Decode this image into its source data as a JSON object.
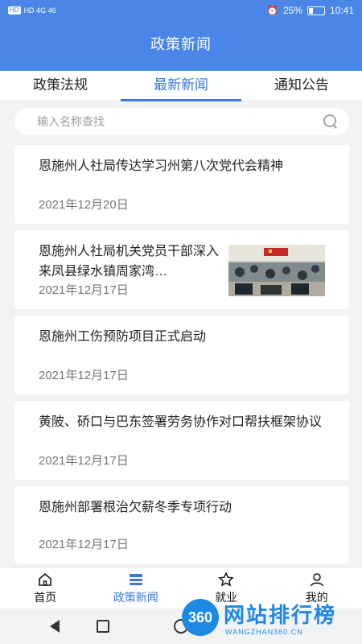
{
  "status_bar": {
    "left_text": "HD 4G 46",
    "battery": "25%",
    "time": "10:41"
  },
  "header": {
    "title": "政策新闻"
  },
  "tabs": [
    {
      "label": "政策法规"
    },
    {
      "label": "最新新闻",
      "active": true
    },
    {
      "label": "通知公告"
    }
  ],
  "search": {
    "placeholder": "输入名称查找",
    "value": ""
  },
  "news": [
    {
      "title": "恩施州人社局传达学习州第八次党代会精神",
      "date": "2021年12月20日",
      "has_image": false
    },
    {
      "title": "恩施州人社局机关党员干部深入来凤县绿水镇周家湾…",
      "date": "2021年12月17日",
      "has_image": true
    },
    {
      "title": "恩施州工伤预防项目正式启动",
      "date": "2021年12月17日",
      "has_image": false
    },
    {
      "title": "黄陂、硚口与巴东签署劳务协作对口帮扶框架协议",
      "date": "2021年12月17日",
      "has_image": false
    },
    {
      "title": "恩施州部署根治欠薪冬季专项行动",
      "date": "2021年12月17日",
      "has_image": false
    }
  ],
  "bottom_nav": [
    {
      "label": "首页",
      "icon": "home-icon"
    },
    {
      "label": "政策新闻",
      "icon": "news-icon",
      "active": true
    },
    {
      "label": "就业",
      "icon": "star-icon"
    },
    {
      "label": "我的",
      "icon": "person-icon"
    }
  ],
  "watermark": {
    "badge": "360",
    "name": "网站排行榜",
    "url": "WANGZHAN360.CN"
  },
  "colors": {
    "primary": "#4a86e8",
    "accent": "#3b78d8",
    "background": "#f2f3f5"
  }
}
